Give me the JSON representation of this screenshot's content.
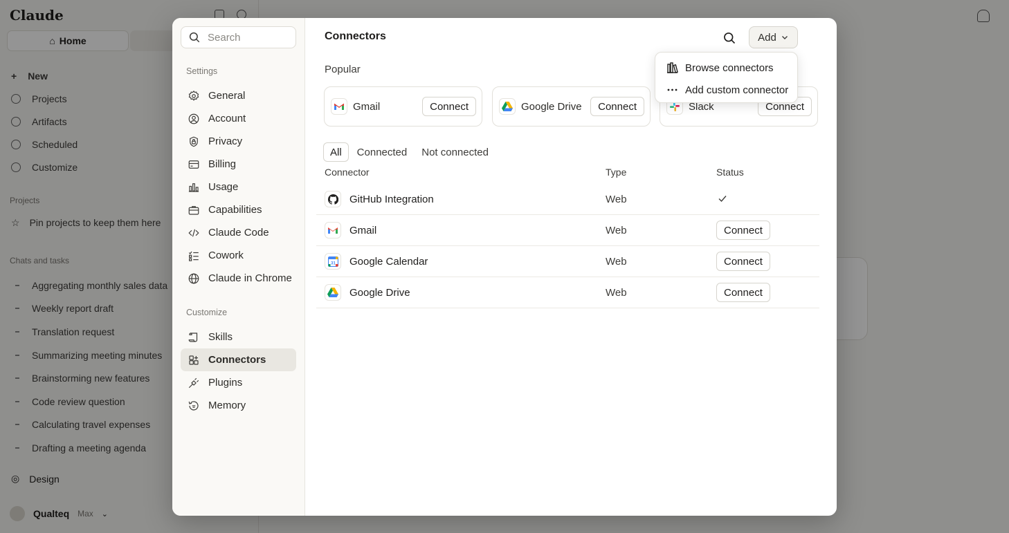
{
  "background": {
    "app_name": "Claude",
    "home_label": "Home",
    "nav": [
      "New",
      "Projects",
      "Artifacts",
      "Scheduled",
      "Customize"
    ],
    "projects_section": "Projects",
    "projects_hint": "Pin projects to keep them here",
    "chats_section": "Chats and tasks",
    "chats": [
      "Aggregating monthly sales data",
      "Weekly report draft",
      "Translation request",
      "Summarizing meeting minutes",
      "Brainstorming new features",
      "Code review question",
      "Calculating travel expenses",
      "Drafting a meeting agenda"
    ],
    "design_label": "Design",
    "user_name": "Qualteq",
    "user_plan": "Max"
  },
  "settings": {
    "search_placeholder": "Search",
    "settings_section": "Settings",
    "settings_items": [
      {
        "label": "General",
        "icon": "gear-icon"
      },
      {
        "label": "Account",
        "icon": "user-circle-icon"
      },
      {
        "label": "Privacy",
        "icon": "shield-lock-icon"
      },
      {
        "label": "Billing",
        "icon": "credit-card-icon"
      },
      {
        "label": "Usage",
        "icon": "bar-chart-icon"
      },
      {
        "label": "Capabilities",
        "icon": "briefcase-icon"
      },
      {
        "label": "Claude Code",
        "icon": "code-icon"
      },
      {
        "label": "Cowork",
        "icon": "checklist-icon"
      },
      {
        "label": "Claude in Chrome",
        "icon": "globe-icon"
      }
    ],
    "customize_section": "Customize",
    "customize_items": [
      {
        "label": "Skills",
        "icon": "scroll-icon"
      },
      {
        "label": "Connectors",
        "icon": "grid-plus-icon",
        "active": true
      },
      {
        "label": "Plugins",
        "icon": "plug-icon"
      },
      {
        "label": "Memory",
        "icon": "memory-icon"
      }
    ]
  },
  "main": {
    "title": "Connectors",
    "add_label": "Add",
    "popular_label": "Popular",
    "popular": [
      {
        "name": "Gmail",
        "action": "Connect",
        "icon": "gmail-icon"
      },
      {
        "name": "Google Drive",
        "action": "Connect",
        "icon": "google-drive-icon"
      },
      {
        "name": "Slack",
        "action": "Connect",
        "icon": "slack-icon"
      }
    ],
    "tabs": [
      "All",
      "Connected",
      "Not connected"
    ],
    "active_tab": "All",
    "columns": [
      "Connector",
      "Type",
      "Status"
    ],
    "rows": [
      {
        "name": "GitHub Integration",
        "type": "Web",
        "status": "connected",
        "action": "",
        "icon": "github-icon"
      },
      {
        "name": "Gmail",
        "type": "Web",
        "status": "not connected",
        "action": "Connect",
        "icon": "gmail-icon"
      },
      {
        "name": "Google Calendar",
        "type": "Web",
        "status": "not connected",
        "action": "Connect",
        "icon": "google-calendar-icon"
      },
      {
        "name": "Google Drive",
        "type": "Web",
        "status": "not connected",
        "action": "Connect",
        "icon": "google-drive-icon"
      }
    ],
    "dropdown": [
      {
        "label": "Browse connectors",
        "icon": "library-icon"
      },
      {
        "label": "Add custom connector",
        "icon": "more-horizontal-icon"
      }
    ]
  },
  "colors": {
    "gmail_red": "#EA4335",
    "drive_green": "#0F9D58",
    "drive_yellow": "#F4B400",
    "drive_blue": "#4285F4",
    "active_item_bg": "#E9E7E1"
  }
}
